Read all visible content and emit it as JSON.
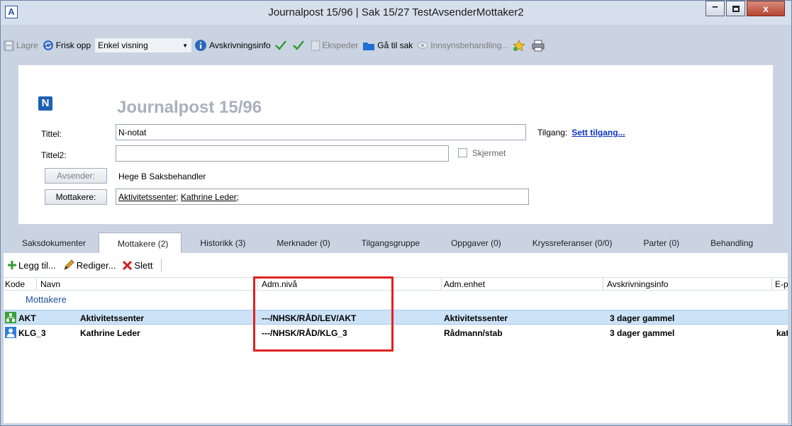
{
  "window": {
    "title": "Journalpost 15/96 | Sak 15/27 TestAvsenderMottaker2",
    "app_icon": "A",
    "minimize": "–",
    "close": "x"
  },
  "toolbar": {
    "save": "Lagre",
    "refresh": "Frisk opp",
    "view_select": "Enkel visning",
    "avskrivning": "Avskrivningsinfo",
    "ekspeder": "Ekspeder",
    "ga_til_sak": "Gå til sak",
    "innsyn": "Innsynsbehandling..."
  },
  "form": {
    "logo": "N",
    "heading": "Journalpost 15/96",
    "tittel_label": "Tittel:",
    "tittel_value": "N-notat",
    "tittel2_label": "Tittel2:",
    "tittel2_value": "",
    "skjermet_label": "Skjermet",
    "tilgang_label": "Tilgang:",
    "tilgang_link": "Sett tilgang...",
    "avsender_button": "Avsender:",
    "avsender_value": "Hege B Saksbehandler",
    "mottakere_button": "Mottakere:",
    "mottakere_values": [
      "Aktivitetssenter",
      "Kathrine Leder"
    ]
  },
  "tabs": [
    {
      "label": "Saksdokumenter",
      "active": false
    },
    {
      "label": "Mottakere (2)",
      "active": true
    },
    {
      "label": "Historikk (3)",
      "active": false
    },
    {
      "label": "Merknader (0)",
      "active": false
    },
    {
      "label": "Tilgangsgruppe",
      "active": false
    },
    {
      "label": "Oppgaver (0)",
      "active": false
    },
    {
      "label": "Kryssreferanser (0/0)",
      "active": false
    },
    {
      "label": "Parter (0)",
      "active": false
    },
    {
      "label": "Behandling",
      "active": false
    }
  ],
  "subtoolbar": {
    "add": "Legg til...",
    "edit": "Rediger...",
    "delete": "Slett"
  },
  "grid": {
    "columns": [
      "Kode",
      "Navn",
      "Adm.nivå",
      "Adm.enhet",
      "Avskrivningsinfo",
      "E-po"
    ],
    "group_label": "Mottakere",
    "rows": [
      {
        "kode": "AKT",
        "navn": "Aktivitetssenter",
        "adm_niva": "---/NHSK/RÅD/LEV/AKT",
        "adm_enhet": "Aktivitetssenter",
        "avskrivning": "3 dager gammel",
        "epost": "",
        "icon": "org-unit-icon",
        "selected": true
      },
      {
        "kode": "KLG_3",
        "navn": "Kathrine Leder",
        "adm_niva": "---/NHSK/RÅD/KLG_3",
        "adm_enhet": "Rådmann/stab",
        "avskrivning": "3 dager gammel",
        "epost": "kat",
        "icon": "person-icon",
        "selected": false
      }
    ]
  },
  "colors": {
    "annotation": "#e02222",
    "link": "#0b34c2",
    "selected_row": "#cce2f6"
  }
}
